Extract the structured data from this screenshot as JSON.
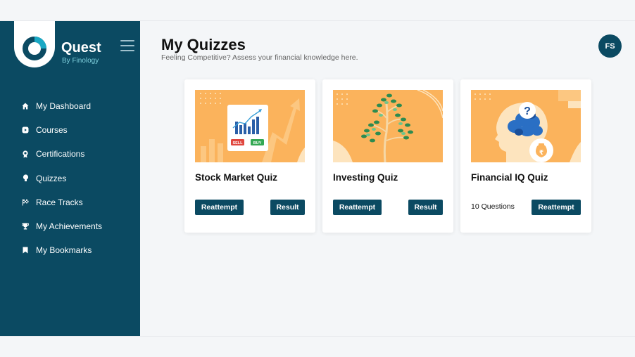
{
  "brand": {
    "name": "Quest",
    "sub": "By Finology"
  },
  "nav": [
    {
      "label": "My Dashboard",
      "icon": "home-icon"
    },
    {
      "label": "Courses",
      "icon": "courses-icon"
    },
    {
      "label": "Certifications",
      "icon": "certificate-icon"
    },
    {
      "label": "Quizzes",
      "icon": "bulb-icon"
    },
    {
      "label": "Race Tracks",
      "icon": "flag-icon"
    },
    {
      "label": "My Achievements",
      "icon": "trophy-icon"
    },
    {
      "label": "My Bookmarks",
      "icon": "bookmark-icon"
    }
  ],
  "header": {
    "title": "My Quizzes",
    "subtitle": "Feeling Competitive? Assess your financial knowledge here.",
    "avatar": "FS"
  },
  "cards": [
    {
      "title": "Stock Market Quiz",
      "primary": "Reattempt",
      "secondary": "Result",
      "sell": "SELL",
      "buy": "BUY"
    },
    {
      "title": "Investing Quiz",
      "primary": "Reattempt",
      "secondary": "Result"
    },
    {
      "title": "Financial IQ Quiz",
      "questions": "10 Questions",
      "primary": "Reattempt",
      "symbol": "?",
      "currency": "₹"
    }
  ],
  "colors": {
    "sidebar": "#0b4a62",
    "accent": "#7fd0dd",
    "card_bg": "#fbb35c",
    "button": "#0b4a62"
  }
}
